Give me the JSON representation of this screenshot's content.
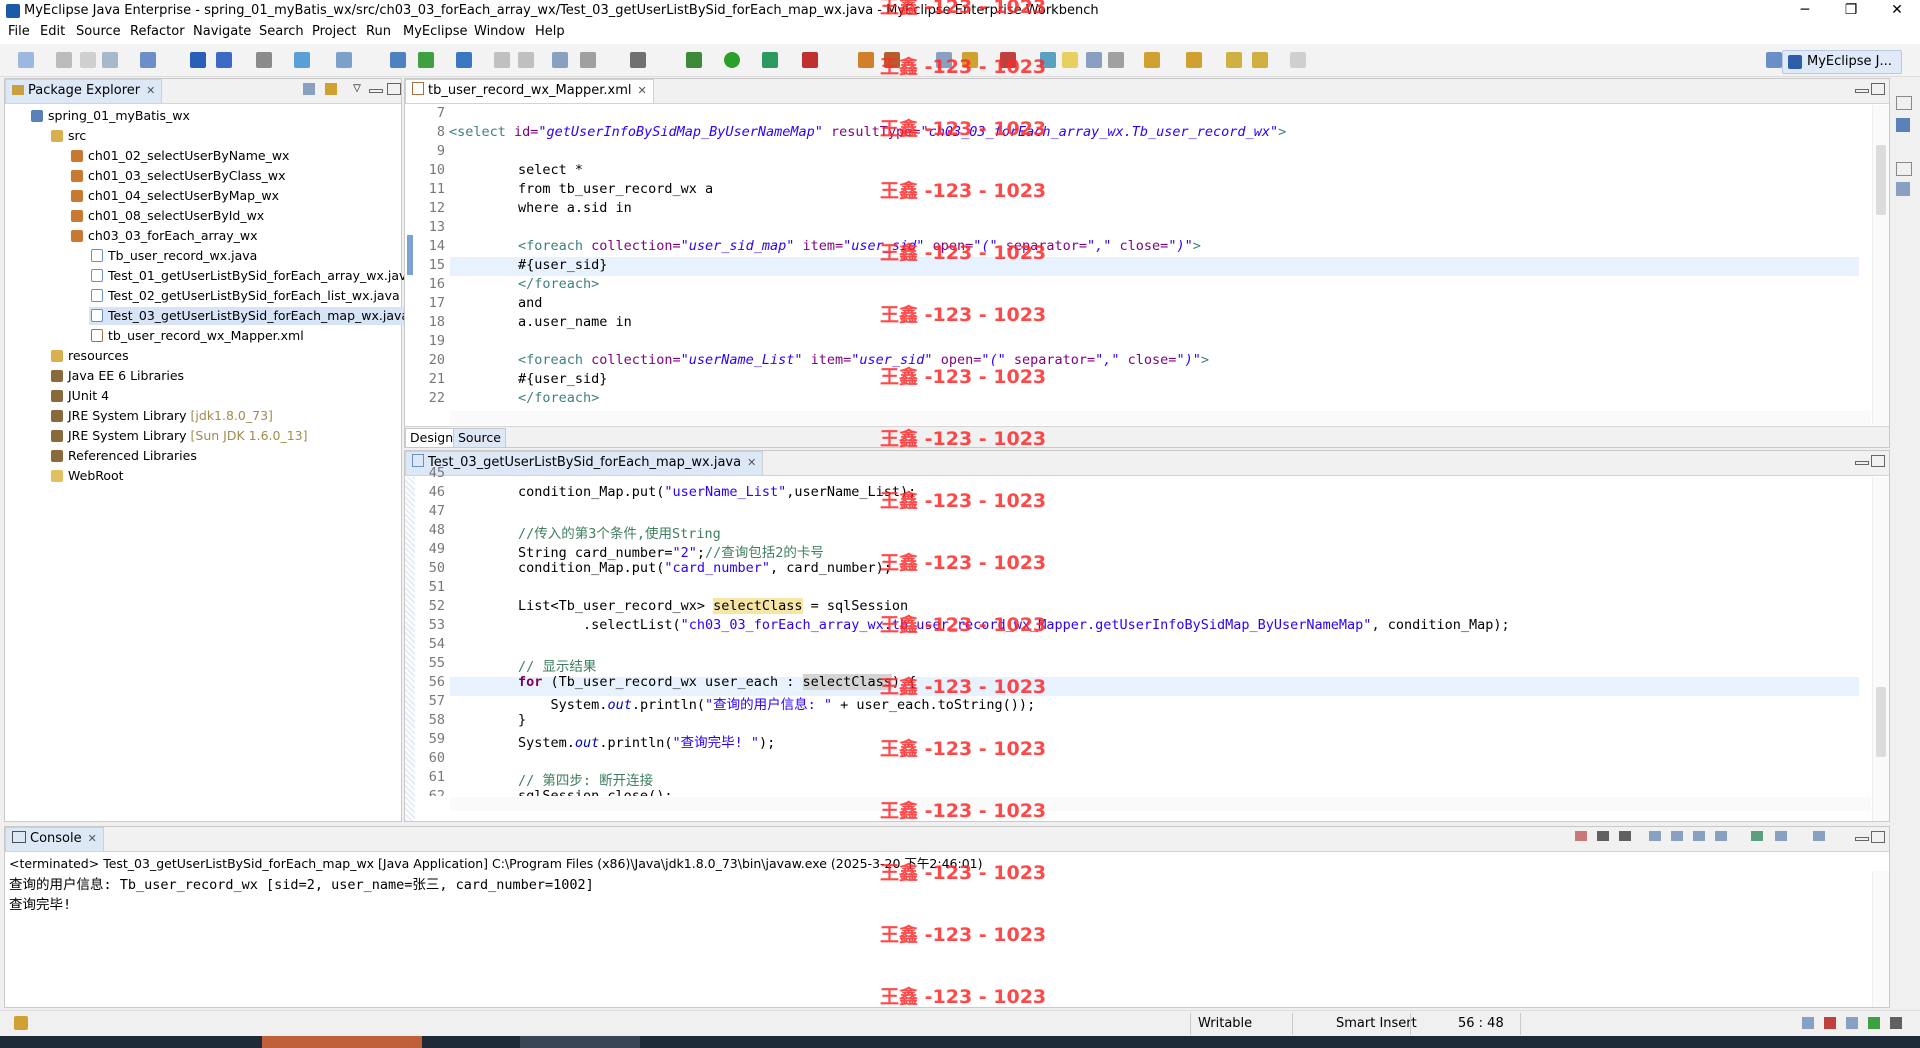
{
  "window": {
    "title": "MyEclipse Java Enterprise - spring_01_myBatis_wx/src/ch03_03_forEach_array_wx/Test_03_getUserListBySid_forEach_map_wx.java - MyEclipse Enterprise Workbench",
    "minimize": "─",
    "restore": "❐",
    "close": "✕"
  },
  "menu": [
    "File",
    "Edit",
    "Source",
    "Refactor",
    "Navigate",
    "Search",
    "Project",
    "Run",
    "MyEclipse",
    "Window",
    "Help"
  ],
  "perspective": {
    "label": "MyEclipse J..."
  },
  "package_explorer": {
    "tab_label": "Package Explorer",
    "items": [
      {
        "label": "spring_01_myBatis_wx",
        "icon": "project-icon"
      },
      {
        "label": "src",
        "icon": "source-folder-icon"
      },
      {
        "label": "ch01_02_selectUserByName_wx",
        "icon": "package-icon"
      },
      {
        "label": "ch01_03_selectUserByClass_wx",
        "icon": "package-icon"
      },
      {
        "label": "ch01_04_selectUserByMap_wx",
        "icon": "package-icon"
      },
      {
        "label": "ch01_08_selectUserById_wx",
        "icon": "package-icon"
      },
      {
        "label": "ch03_03_forEach_array_wx",
        "icon": "package-icon"
      },
      {
        "label": "Tb_user_record_wx.java",
        "icon": "java-file-icon"
      },
      {
        "label": "Test_01_getUserListBySid_forEach_array_wx.java",
        "icon": "java-file-icon"
      },
      {
        "label": "Test_02_getUserListBySid_forEach_list_wx.java",
        "icon": "java-file-icon"
      },
      {
        "label": "Test_03_getUserListBySid_forEach_map_wx.java",
        "icon": "java-file-icon"
      },
      {
        "label": "tb_user_record_wx_Mapper.xml",
        "icon": "xml-file-icon"
      },
      {
        "label": "resources",
        "icon": "source-folder-icon"
      },
      {
        "label": "Java EE 6 Libraries",
        "icon": "library-icon"
      },
      {
        "label": "JUnit 4",
        "icon": "library-icon"
      },
      {
        "label": "JRE System Library",
        "decoration": "[jdk1.8.0_73]",
        "icon": "library-icon"
      },
      {
        "label": "JRE System Library",
        "decoration": "[Sun JDK 1.6.0_13]",
        "icon": "library-icon"
      },
      {
        "label": "Referenced Libraries",
        "icon": "library-icon"
      },
      {
        "label": "WebRoot",
        "icon": "folder-icon"
      }
    ]
  },
  "xml_editor": {
    "tab_label": "tb_user_record_wx_Mapper.xml",
    "line_numbers": [
      "7",
      "8",
      "9",
      "10",
      "11",
      "12",
      "13",
      "14",
      "15",
      "16",
      "17",
      "18",
      "19",
      "20",
      "21",
      "22"
    ],
    "lines": {
      "l7": "",
      "l8a": "<select ",
      "l8b": "id=",
      "l8c": "\"getUserInfoBySidMap_ByUserNameMap\"",
      "l8d": " resultType=",
      "l8e": "\"ch03_03_forEach_array_wx.Tb_user_record_wx\"",
      "l8f": ">",
      "l10": "        select *",
      "l11": "        from tb_user_record_wx a",
      "l12": "        where a.sid in",
      "l14a": "        <foreach ",
      "l14b": "collection=",
      "l14c": "\"user_sid_map\"",
      "l14d": " item=",
      "l14e": "\"user_sid\"",
      "l14f": " open=",
      "l14g": "\"(\"",
      "l14h": " separator=",
      "l14i": "\",\"",
      "l14j": " close=",
      "l14k": "\")\"",
      "l14l": ">",
      "l15": "        #{user_sid}",
      "l16": "        </foreach>",
      "l17": "        and",
      "l18": "        a.user_name in",
      "l20a": "        <foreach ",
      "l20b": "collection=",
      "l20c": "\"userName_List\"",
      "l20d": " item=",
      "l20e": "\"user_sid\"",
      "l20f": " open=",
      "l20g": "\"(\"",
      "l20h": " separator=",
      "l20i": "\",\"",
      "l20j": " close=",
      "l20k": "\")\"",
      "l20l": ">",
      "l21": "        #{user_sid}",
      "l22": "        </foreach>"
    },
    "subtabs": [
      "Design",
      "Source"
    ]
  },
  "java_editor": {
    "tab_label": "Test_03_getUserListBySid_forEach_map_wx.java",
    "line_numbers": [
      "45",
      "46",
      "47",
      "48",
      "49",
      "50",
      "51",
      "52",
      "53",
      "54",
      "55",
      "56",
      "57",
      "58",
      "59",
      "60",
      "61",
      "62"
    ],
    "lines": {
      "l46a": "        condition_Map.put(",
      "l46b": "\"userName_List\"",
      "l46c": ",userName_List);",
      "l48": "        //传入的第3个条件,使用String",
      "l49a": "        String card_number=",
      "l49b": "\"2\"",
      "l49c": ";",
      "l49d": "//查询包括2的卡号",
      "l50a": "        condition_Map.put(",
      "l50b": "\"card_number\"",
      "l50c": ", card_number);",
      "l52a": "        List<Tb_user_record_wx> ",
      "l52b": "selectClass",
      "l52c": " = sqlSession",
      "l53a": "                .selectList(",
      "l53b": "\"ch03_03_forEach_array_wx.tb_user_record_wx_Mapper.getUserInfoBySidMap_ByUserNameMap\"",
      "l53c": ", condition_Map);",
      "l55": "        // 显示结果",
      "l56a": "for",
      "l56b": " (Tb_user_record_wx user_each : ",
      "l56c": "selectClass",
      "l56d": ") {",
      "l57a": "            System.",
      "l57b": "out",
      "l57c": ".println(",
      "l57d": "\"查询的用户信息: \"",
      "l57e": " + user_each.toString());",
      "l58": "        }",
      "l59a": "        System.",
      "l59b": "out",
      "l59c": ".println(",
      "l59d": "\"查询完毕! \"",
      "l59e": ");",
      "l61": "        // 第四步: 断开连接",
      "l62": "        sqlSession.close();"
    }
  },
  "console": {
    "tab_label": "Console",
    "header": "<terminated> Test_03_getUserListBySid_forEach_map_wx [Java Application] C:\\Program Files (x86)\\Java\\jdk1.8.0_73\\bin\\javaw.exe (2025-3-20 下午2:46:01)",
    "output": [
      "查询的用户信息: Tb_user_record_wx [sid=2, user_name=张三, card_number=1002]",
      "查询完毕!"
    ]
  },
  "status": {
    "writable": "Writable",
    "insert_mode": "Smart Insert",
    "cursor": "56 : 48"
  },
  "watermark": {
    "text": "王鑫 -123 - 1023"
  },
  "colors": {
    "accent": "#dde8f6",
    "watermark": "#ff2a2a"
  }
}
